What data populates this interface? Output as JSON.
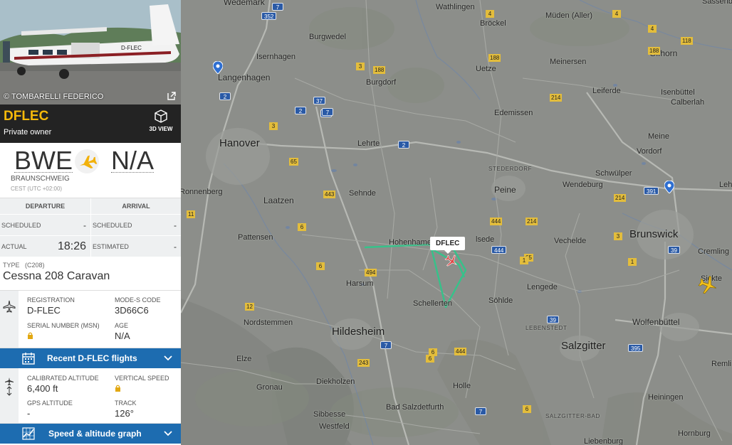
{
  "flight": {
    "photo_credit": "© TOMBARELLI FEDERICO",
    "callsign": "DFLEC",
    "owner": "Private owner",
    "view3d_label": "3D VIEW",
    "origin_code": "BWE",
    "origin_city": "BRAUNSCHWEIG",
    "origin_tz": "CEST (UTC +02:00)",
    "destination_code": "N/A",
    "departure_header": "DEPARTURE",
    "arrival_header": "ARRIVAL",
    "scheduled_label": "SCHEDULED",
    "scheduled_dep": "-",
    "scheduled_arr": "-",
    "actual_label": "ACTUAL",
    "actual_dep": "18:26",
    "estimated_label": "ESTIMATED",
    "estimated_arr": "-",
    "type_label": "TYPE",
    "type_code": "(C208)",
    "aircraft_type": "Cessna 208 Caravan",
    "registration_label": "REGISTRATION",
    "registration": "D-FLEC",
    "modes_label": "MODE-S CODE",
    "modes": "3D66C6",
    "serial_label": "SERIAL NUMBER (MSN)",
    "age_label": "AGE",
    "age": "N/A",
    "recent_flights_label": "Recent D-FLEC flights",
    "calibrated_alt_label": "CALIBRATED ALTITUDE",
    "calibrated_alt": "6,400 ft",
    "vspeed_label": "VERTICAL SPEED",
    "gps_alt_label": "GPS ALTITUDE",
    "gps_alt": "-",
    "track_label": "TRACK",
    "track": "126°",
    "speed_graph_label": "Speed & altitude graph"
  },
  "map": {
    "callout": "DFLEC",
    "places": [
      {
        "name": "Wedemark",
        "cls": "town"
      },
      {
        "name": "Wathlingen",
        "cls": ""
      },
      {
        "name": "Müden (Aller)",
        "cls": ""
      },
      {
        "name": "Sassenb",
        "cls": ""
      },
      {
        "name": "Bröckel",
        "cls": ""
      },
      {
        "name": "Burgwedel",
        "cls": ""
      },
      {
        "name": "Isernhagen",
        "cls": ""
      },
      {
        "name": "Langenhagen",
        "cls": "town"
      },
      {
        "name": "Uetze",
        "cls": ""
      },
      {
        "name": "Meinersen",
        "cls": ""
      },
      {
        "name": "Gifhorn",
        "cls": "town"
      },
      {
        "name": "Burgdorf",
        "cls": ""
      },
      {
        "name": "Leiferde",
        "cls": ""
      },
      {
        "name": "Isenbüttel",
        "cls": ""
      },
      {
        "name": "Calberlah",
        "cls": ""
      },
      {
        "name": "Hanover",
        "cls": "city"
      },
      {
        "name": "Lehrte",
        "cls": ""
      },
      {
        "name": "Edemissen",
        "cls": ""
      },
      {
        "name": "Meine",
        "cls": ""
      },
      {
        "name": "Vordorf",
        "cls": ""
      },
      {
        "name": "STEDERDORF",
        "cls": "dist"
      },
      {
        "name": "Schwülper",
        "cls": ""
      },
      {
        "name": "Wendeburg",
        "cls": ""
      },
      {
        "name": "Ronnenberg",
        "cls": ""
      },
      {
        "name": "Sehnde",
        "cls": ""
      },
      {
        "name": "Peine",
        "cls": "town"
      },
      {
        "name": "Laatzen",
        "cls": "town"
      },
      {
        "name": "Lehr",
        "cls": ""
      },
      {
        "name": "Pattensen",
        "cls": ""
      },
      {
        "name": "Hohenhameln",
        "cls": ""
      },
      {
        "name": "lsede",
        "cls": ""
      },
      {
        "name": "Vechelde",
        "cls": ""
      },
      {
        "name": "Brunswick",
        "cls": "city"
      },
      {
        "name": "Cremling",
        "cls": ""
      },
      {
        "name": "Harsum",
        "cls": ""
      },
      {
        "name": "Lengede",
        "cls": ""
      },
      {
        "name": "Sickte",
        "cls": ""
      },
      {
        "name": "Schellerten",
        "cls": ""
      },
      {
        "name": "Söhlde",
        "cls": ""
      },
      {
        "name": "Nordstemmen",
        "cls": ""
      },
      {
        "name": "Hildesheim",
        "cls": "city"
      },
      {
        "name": "LEBENSTEDT",
        "cls": "dist"
      },
      {
        "name": "Wolfenbüttel",
        "cls": "town"
      },
      {
        "name": "Salzgitter",
        "cls": "city"
      },
      {
        "name": "Elze",
        "cls": ""
      },
      {
        "name": "Remli",
        "cls": ""
      },
      {
        "name": "Diekholzen",
        "cls": ""
      },
      {
        "name": "Gronau",
        "cls": ""
      },
      {
        "name": "Holle",
        "cls": ""
      },
      {
        "name": "Heiningen",
        "cls": ""
      },
      {
        "name": "Sibbesse",
        "cls": ""
      },
      {
        "name": "Bad Salzdetfurth",
        "cls": ""
      },
      {
        "name": "SALZGITTER-BAD",
        "cls": "dist"
      },
      {
        "name": "Westfeld",
        "cls": ""
      },
      {
        "name": "Liebenburg",
        "cls": ""
      },
      {
        "name": "Hornburg",
        "cls": ""
      }
    ],
    "blue_shields": [
      "352",
      "7",
      "2",
      "37",
      "2",
      "7",
      "2",
      "7",
      "444",
      "391",
      "39",
      "39",
      "395",
      "7",
      "7"
    ],
    "yellow_shields": [
      "4",
      "188",
      "3",
      "188",
      "214",
      "188",
      "4",
      "118",
      "4",
      "3",
      "214",
      "65",
      "443",
      "6",
      "214",
      "65",
      "444",
      "1",
      "6",
      "494",
      "12",
      "6",
      "243",
      "444",
      "6",
      "6",
      "1",
      "11",
      "3"
    ]
  }
}
